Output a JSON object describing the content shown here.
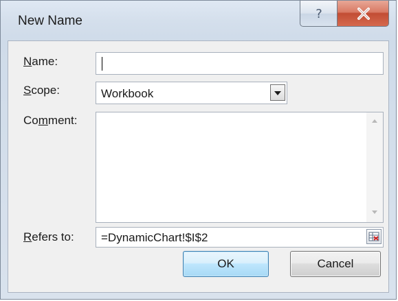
{
  "dialog": {
    "title": "New Name"
  },
  "titlebar": {
    "help_icon": "question-mark-icon",
    "close_icon": "close-x-icon"
  },
  "fields": {
    "name_label_hotkey": "N",
    "name_label_rest": "ame:",
    "name_value": "",
    "scope_label_hotkey": "S",
    "scope_label_rest": "cope:",
    "scope_value": "Workbook",
    "comment_label_pre": "Co",
    "comment_label_hotkey": "m",
    "comment_label_rest": "ment:",
    "comment_value": "",
    "refers_label_hotkey": "R",
    "refers_label_rest": "efers to:",
    "refers_value": "=DynamicChart!$I$2"
  },
  "buttons": {
    "ok_label": "OK",
    "cancel_label": "Cancel"
  },
  "colors": {
    "close_button": "#c24d34",
    "ok_border": "#3c7fb1"
  }
}
